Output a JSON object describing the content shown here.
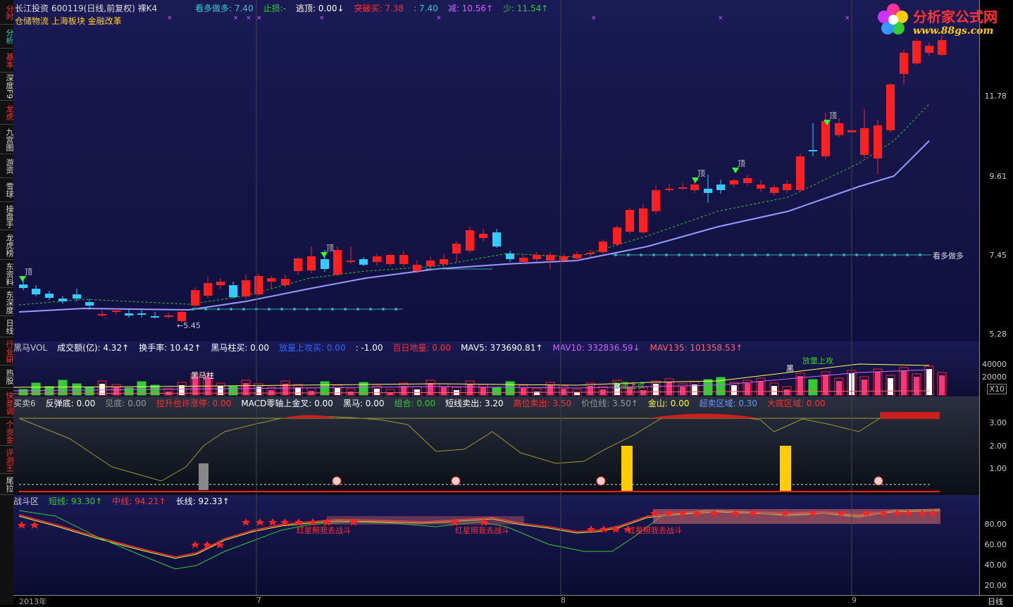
{
  "left_tabs": [
    {
      "label": "分时",
      "color": "red"
    },
    {
      "label": "分析",
      "color": "cyan"
    },
    {
      "label": "基本",
      "color": "red"
    },
    {
      "label": "深度F9",
      "color": "white"
    },
    {
      "label": "龙虎",
      "color": "red"
    },
    {
      "label": "九宫图",
      "color": "white"
    },
    {
      "label": "游资",
      "color": "white"
    },
    {
      "label": "雪球",
      "color": "white"
    },
    {
      "label": "操盘手",
      "color": "white"
    },
    {
      "label": "龙虎榜",
      "color": "white"
    },
    {
      "label": "东资料",
      "color": "white"
    },
    {
      "label": "东深度",
      "color": "white"
    },
    {
      "label": "日线",
      "color": "white"
    },
    {
      "label": "行业研",
      "color": "red"
    },
    {
      "label": "热股",
      "color": "white"
    },
    {
      "label": "快意调",
      "color": "red"
    },
    {
      "label": "个资金",
      "color": "red"
    },
    {
      "label": "评测王",
      "color": "red"
    },
    {
      "label": "尾拉",
      "color": "white"
    }
  ],
  "header": {
    "stock": "长江投资 600119(日线,前复权) 裸K4",
    "concepts": "仓储物流 上海板块 金融改革",
    "items": [
      {
        "text": "看多做多: 7.40",
        "color": "#33cccc"
      },
      {
        "text": "止损:-",
        "color": "#33cc33"
      },
      {
        "text": "逃顶: 0.00↓",
        "color": "#ffffff"
      },
      {
        "text": "突破买: 7.38",
        "color": "#ff3333"
      },
      {
        "text": ": 7.40",
        "color": "#33cccc"
      },
      {
        "text": "减: 10.56↑",
        "color": "#cc66ff"
      },
      {
        "text": "少: 11.54↑",
        "color": "#33cc33"
      }
    ]
  },
  "logo": {
    "title": "分析家公式网",
    "url": "www.88gs.com"
  },
  "price_axis": [
    "11.78",
    "9.61",
    "7.45",
    "5.28"
  ],
  "price_annotations": {
    "support_label": "看多做多",
    "low_label": "←5.45",
    "top_label": "顶"
  },
  "vol_header": [
    {
      "text": "黑马VOL",
      "color": "#cccccc"
    },
    {
      "text": "成交额(亿): 4.32↑",
      "color": "#ffffff"
    },
    {
      "text": "换手率: 10.42↑",
      "color": "#ffffff"
    },
    {
      "text": "黑马柱买: 0.00",
      "color": "#ffffff"
    },
    {
      "text": "放量上攻买: 0.00",
      "color": "#3366ff"
    },
    {
      "text": ": -1.00",
      "color": "#ffffff"
    },
    {
      "text": "百日地量: 0.00",
      "color": "#ff3333"
    },
    {
      "text": "MAV5: 373690.81↑",
      "color": "#ffffff"
    },
    {
      "text": "MAV10: 332836.59↓",
      "color": "#cc66ff"
    },
    {
      "text": "MAV135: 101358.53↑",
      "color": "#ff6666"
    }
  ],
  "vol_axis": [
    "40000",
    "20000"
  ],
  "vol_scale": "X10",
  "vol_annotations": {
    "heima": "黑马柱",
    "fangliang": "放量上攻",
    "fangliang2": "放量上攻",
    "hei": "黑"
  },
  "bs_header": [
    {
      "text": "买卖6",
      "color": "#cccccc"
    },
    {
      "text": "反弹底: 0.00",
      "color": "#ffffff"
    },
    {
      "text": "见底: 0.00",
      "color": "#999999"
    },
    {
      "text": "拉升也许涨停: 0.00",
      "color": "#ff3333"
    },
    {
      "text": "MACD零轴上金叉: 0.00",
      "color": "#ffffff"
    },
    {
      "text": "黑马: 0.00",
      "color": "#ffffff"
    },
    {
      "text": "组合: 0.00",
      "color": "#33cc33"
    },
    {
      "text": "短线卖出: 3.20",
      "color": "#ffffff"
    },
    {
      "text": "高位卖出: 3.50",
      "color": "#ff3333"
    },
    {
      "text": "价位线: 3.50↑",
      "color": "#999999"
    },
    {
      "text": "金山: 0.00",
      "color": "#ffff33"
    },
    {
      "text": "超卖区域: 0.30",
      "color": "#6699ff"
    },
    {
      "text": "大底区域: 0.00",
      "color": "#ff3333"
    }
  ],
  "bs_axis": [
    "3.00",
    "2.00",
    "1.00"
  ],
  "zd_header": [
    {
      "text": "战斗区",
      "color": "#cccccc"
    },
    {
      "text": "短线: 93.30↑",
      "color": "#33cc33"
    },
    {
      "text": "中线: 94.21↑",
      "color": "#ff3333"
    },
    {
      "text": "长线: 92.33↑",
      "color": "#ffffff"
    }
  ],
  "zd_axis": [
    "80.00",
    "60.00",
    "40.00",
    "20.00"
  ],
  "zd_labels": [
    "红星照我去战斗",
    "红星照我去战斗",
    "红星照我去战斗"
  ],
  "x_axis": {
    "labels": [
      "2013年",
      "7",
      "8",
      "9"
    ],
    "period": "日线"
  },
  "colors": {
    "up": "#ff2020",
    "down": "#33ccff",
    "ma_slow": "#9999ff",
    "ma_fast": "#33cc33",
    "support": "#33aaaa"
  }
}
